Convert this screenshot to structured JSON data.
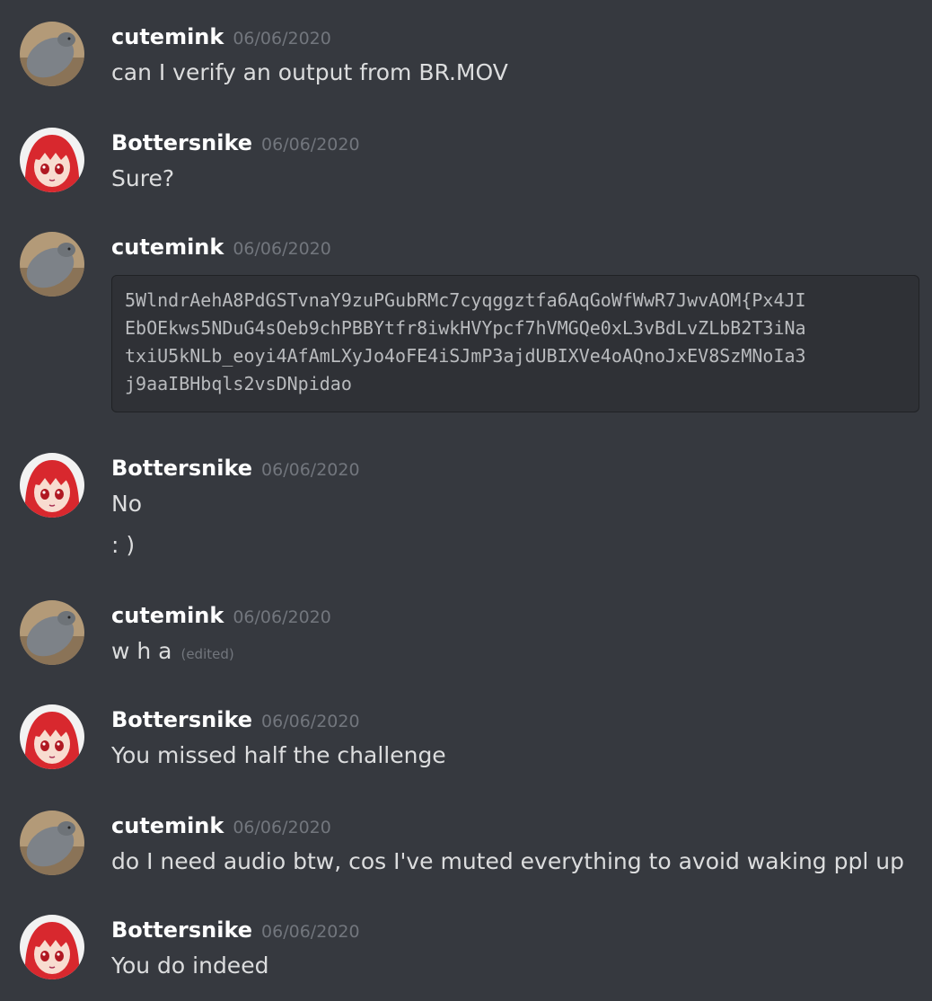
{
  "messages": [
    {
      "author": "cutemink",
      "time": "06/06/2020",
      "avatar": "seal-avatar-icon",
      "lines": [
        "can I verify an output from BR.MOV"
      ]
    },
    {
      "author": "Bottersnike",
      "time": "06/06/2020",
      "avatar": "anime-girl-avatar-icon",
      "lines": [
        "Sure?"
      ]
    },
    {
      "author": "cutemink",
      "time": "06/06/2020",
      "avatar": "seal-avatar-icon",
      "code_lines": [
        "5WlndrAehA8PdGSTvnaY9zuPGubRMc7cyqggztfa6AqGoWfWwR7JwvAOM{Px4JI",
        "EbOEkws5NDuG4sOeb9chPBBYtfr8iwkHVYpcf7hVMGQe0xL3vBdLvZLbB2T3iNa",
        "txiU5kNLb_eoyi4AfAmLXyJo4oFE4iSJmP3ajdUBIXVe4oAQnoJxEV8SzMNoIa3",
        "j9aaIBHbqls2vsDNpidao"
      ]
    },
    {
      "author": "Bottersnike",
      "time": "06/06/2020",
      "avatar": "anime-girl-avatar-icon",
      "lines": [
        "No",
        ": )"
      ]
    },
    {
      "author": "cutemink",
      "time": "06/06/2020",
      "avatar": "seal-avatar-icon",
      "lines": [
        "w h a"
      ],
      "edited": "(edited)"
    },
    {
      "author": "Bottersnike",
      "time": "06/06/2020",
      "avatar": "anime-girl-avatar-icon",
      "lines": [
        "You missed half the challenge"
      ]
    },
    {
      "author": "cutemink",
      "time": "06/06/2020",
      "avatar": "seal-avatar-icon",
      "lines": [
        "do I need audio btw, cos I've muted everything to avoid waking ppl up"
      ]
    },
    {
      "author": "Bottersnike",
      "time": "06/06/2020",
      "avatar": "anime-girl-avatar-icon",
      "lines": [
        "You do indeed"
      ]
    }
  ],
  "colors": {
    "background": "#36393f",
    "username": "#ffffff",
    "timestamp": "#72767d",
    "text": "#dcddde",
    "code_background": "#2f3136"
  }
}
